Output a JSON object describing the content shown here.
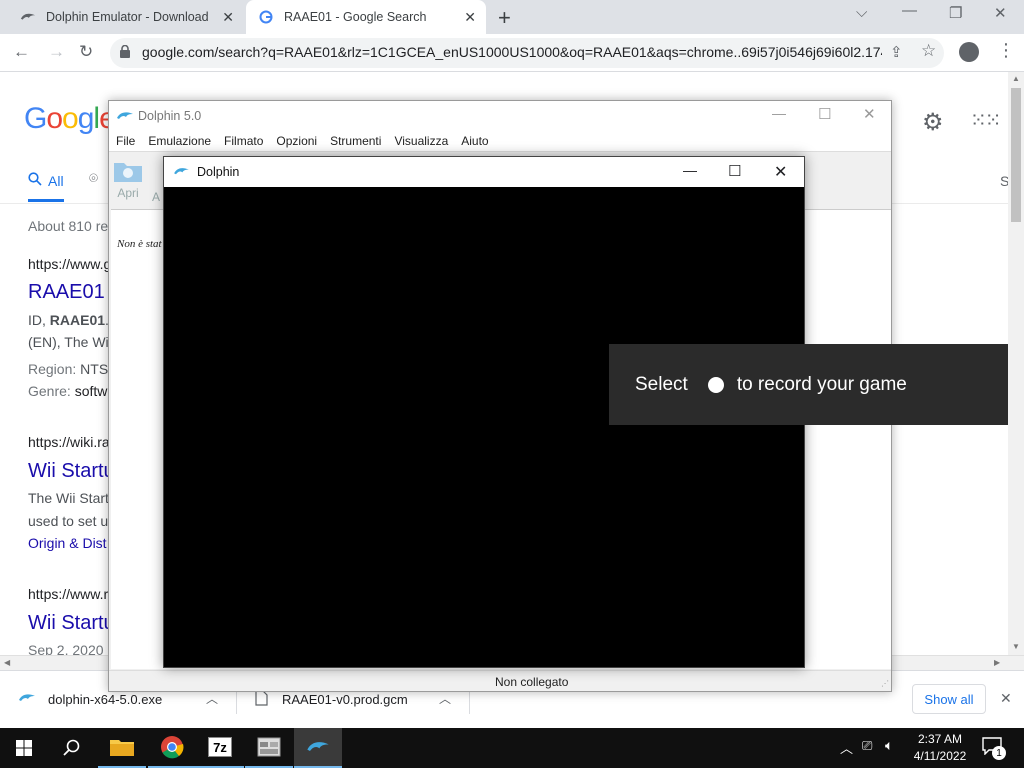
{
  "browser": {
    "tabs": [
      {
        "title": "Dolphin Emulator - Download"
      },
      {
        "title": "RAAE01 - Google Search"
      }
    ],
    "url": "google.com/search?q=RAAE01&rlz=1C1GCEA_enUS1000US1000&oq=RAAE01&aqs=chrome..69i57j0i546j69i60l2.174..."
  },
  "google": {
    "logo": "Googl",
    "tabs": {
      "all": "All",
      "s": "S"
    },
    "about": "About 810 re",
    "results": [
      {
        "url": "https://www.g",
        "title": "RAAE01",
        "line1_a": "ID, ",
        "line1_b": "RAAE01",
        "line1_c": ".",
        "line2": "(EN), The Wi",
        "region_label": "Region: ",
        "region": "NTS",
        "genre_label": "Genre: ",
        "genre": "softw"
      },
      {
        "url": "https://wiki.ra",
        "title": "Wii Startu",
        "line1": "The Wii Start",
        "line2": "used to set u",
        "link": "Origin & Dist"
      },
      {
        "url": "https://www.r",
        "title": "Wii Startu",
        "date": "Sep 2, 2020"
      }
    ]
  },
  "dolphin_main": {
    "title": "Dolphin 5.0",
    "menu": [
      "File",
      "Emulazione",
      "Filmato",
      "Opzioni",
      "Strumenti",
      "Visualizza",
      "Aiuto"
    ],
    "toolbar": {
      "open": "Apri",
      "next": "A"
    },
    "list_text": "Non è stat",
    "status": "Non collegato"
  },
  "dolphin_render": {
    "title": "Dolphin"
  },
  "overlay": {
    "prefix": "Select",
    "suffix": "to record your game"
  },
  "downloads": {
    "items": [
      {
        "name": "dolphin-x64-5.0.exe"
      },
      {
        "name": "RAAE01-v0.prod.gcm"
      }
    ],
    "show_all": "Show all"
  },
  "taskbar": {
    "time": "2:37 AM",
    "date": "4/11/2022",
    "notif_count": "1"
  },
  "colors": {
    "link": "#1a0dab",
    "google_blue": "#1a73e8",
    "dolphin_blue": "#3fa6dd"
  }
}
